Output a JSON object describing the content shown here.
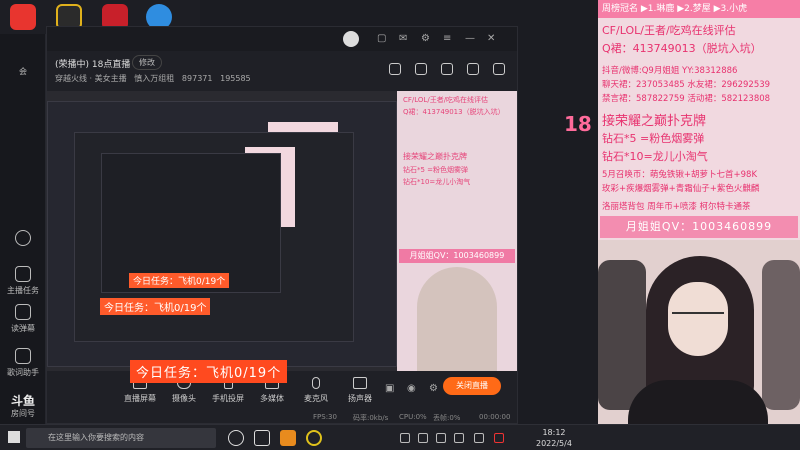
{
  "app": {
    "room_title": "(荣播中) 18点直播",
    "edit_label": "修改",
    "category": "穿越火线 · 美女主播",
    "followers": "慎入万组租",
    "room_id": "897371",
    "fans_count": "195585"
  },
  "left_strip": {
    "label": "会",
    "items": [
      "主播任务",
      "读弹幕",
      "歌词助手"
    ],
    "logo": "斗鱼",
    "logo_sub": "房间号"
  },
  "controls": {
    "items": [
      "直播屏幕",
      "摄像头",
      "手机投屏",
      "多媒体",
      "麦克风",
      "扬声器"
    ],
    "close_live": "关闭直播"
  },
  "stats": {
    "fps": "FPS:30",
    "bitrate": "码率:0kb/s",
    "cpu": "CPU:0%",
    "drop": "丢帧:0%",
    "time": "00:00:00"
  },
  "task": {
    "big_text": "今日任务：飞机0/19个",
    "mini_text": "今日任务：飞机0/19个"
  },
  "overlay": {
    "header": "周榜冠名 ▶1.琳鹿 ▶2.梦屋 ▶3.小虎",
    "line1": "CF/LOL/王者/吃鸡在线评估",
    "line2": "Q裙：413749013（脱坑入坑）",
    "line3": "抖音/微博:Q9月姐姐   YY:38312886",
    "line4": "聊天裙：237053485  水友裙：296292539",
    "line5": "禁言裙：587822759  活动裙：582123808",
    "line6": "接荣耀之巅扑克牌",
    "line7": "钻石*5 =粉色烟雾弹",
    "line8": "钻石*10=龙儿小淘气",
    "line9": "5月召唤币：萌兔铁锹+胡萝卜七首+98K",
    "line10": "玫彩+疾爆烟雾弹+青霜仙子+紫色火麒麟",
    "line11": "洛丽塔背包  周年币+喷漆  柯尔特卡通茶",
    "qq": "月姐姐QV：1003460899",
    "badge18": "18"
  },
  "taskbar": {
    "search_placeholder": "在这里输入你要搜索的内容",
    "time": "18:12",
    "date": "2022/5/4"
  }
}
